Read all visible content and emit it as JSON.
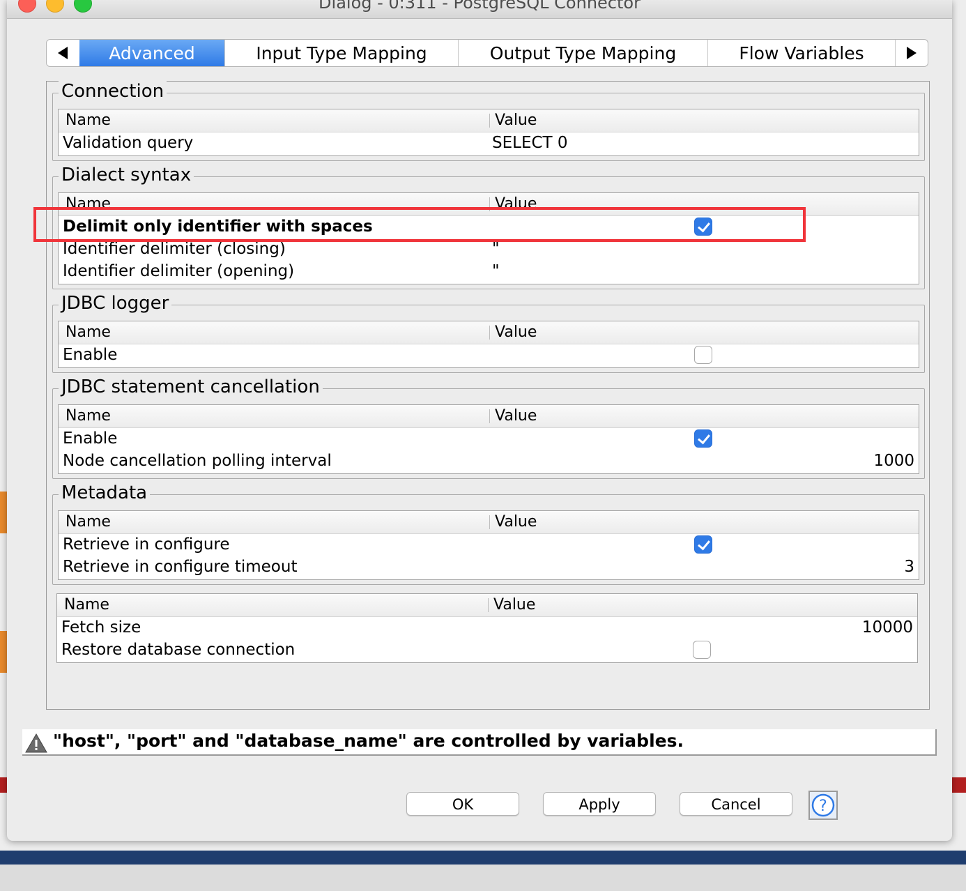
{
  "window": {
    "title": "Dialog - 0:311 - PostgreSQL Connector"
  },
  "tabs": [
    {
      "label": "Advanced",
      "active": true
    },
    {
      "label": "Input Type Mapping",
      "active": false
    },
    {
      "label": "Output Type Mapping",
      "active": false
    },
    {
      "label": "Flow Variables",
      "active": false
    }
  ],
  "table_headers": {
    "name": "Name",
    "value": "Value"
  },
  "groups": {
    "connection": {
      "title": "Connection",
      "rows": [
        {
          "name": "Validation query",
          "value": "SELECT 0"
        }
      ]
    },
    "dialect": {
      "title": "Dialect syntax",
      "rows": [
        {
          "name": "Delimit only identifier with spaces",
          "checked": true
        },
        {
          "name": "Identifier delimiter (closing)",
          "value": "\""
        },
        {
          "name": "Identifier delimiter (opening)",
          "value": "\""
        }
      ]
    },
    "jdbc_logger": {
      "title": "JDBC logger",
      "rows": [
        {
          "name": "Enable",
          "checked": false
        }
      ]
    },
    "cancellation": {
      "title": "JDBC statement cancellation",
      "rows": [
        {
          "name": "Enable",
          "checked": true
        },
        {
          "name": "Node cancellation polling interval",
          "value": "1000"
        }
      ]
    },
    "metadata": {
      "title": "Metadata",
      "rows": [
        {
          "name": "Retrieve in configure",
          "checked": true
        },
        {
          "name": "Retrieve in configure timeout",
          "value": "3"
        }
      ]
    },
    "misc": {
      "rows": [
        {
          "name": "Fetch size",
          "value": "10000"
        },
        {
          "name": "Restore database connection",
          "checked": false
        }
      ]
    }
  },
  "warning": {
    "text": "\"host\", \"port\" and \"database_name\" are controlled by variables."
  },
  "buttons": {
    "ok": "OK",
    "apply": "Apply",
    "cancel": "Cancel"
  },
  "colors": {
    "accent": "#2f7ae6",
    "highlight": "#f0343a",
    "warning_text": "#000000"
  },
  "icons": {
    "left": "arrow-left-icon",
    "right": "arrow-right-icon",
    "warning": "warning-triangle-icon",
    "help": "help-icon"
  }
}
